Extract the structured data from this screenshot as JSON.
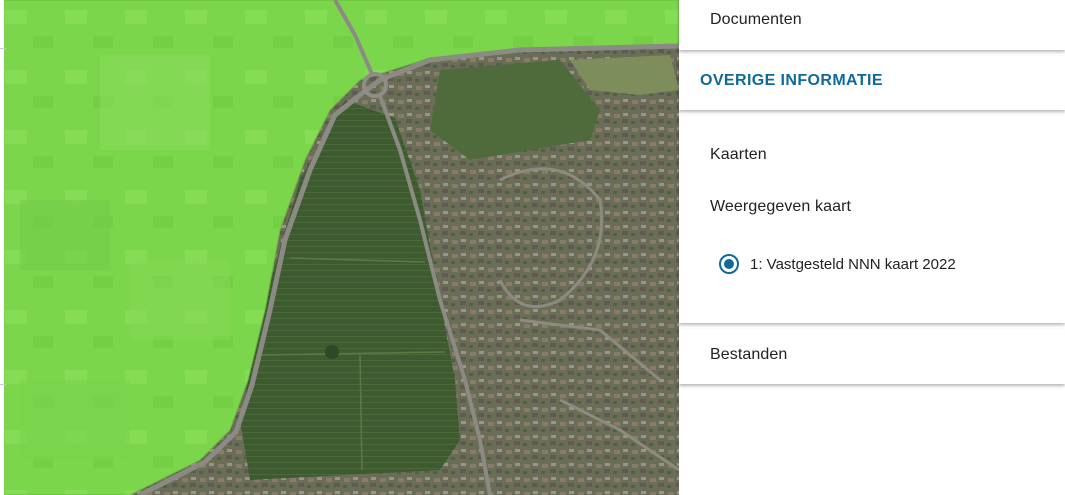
{
  "map": {
    "overlay_color": "#7fd84c",
    "overlay_label": "",
    "aerial_description_colors": {
      "field_dark": "#3f5a32",
      "residential": "#6d6f58",
      "road": "#8e8e86"
    }
  },
  "panel": {
    "documents_label": "Documenten",
    "overige_title": "OVERIGE INFORMATIE",
    "kaarten_label": "Kaarten",
    "weergegeven_label": "Weergegeven kaart",
    "map_option": {
      "label": "1: Vastgesteld NNN kaart 2022",
      "selected": true
    },
    "bestanden_label": "Bestanden",
    "accent_color": "#0e6a99"
  }
}
